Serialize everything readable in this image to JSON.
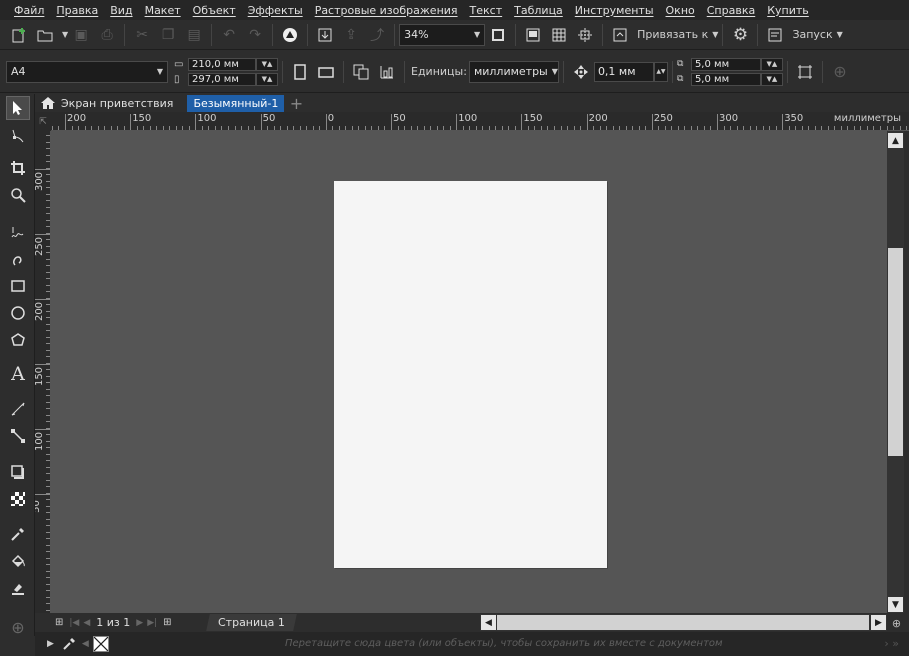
{
  "menu": [
    "Файл",
    "Правка",
    "Вид",
    "Макет",
    "Объект",
    "Эффекты",
    "Растровые изображения",
    "Текст",
    "Таблица",
    "Инструменты",
    "Окно",
    "Справка",
    "Купить"
  ],
  "toolbar1": {
    "zoom": "34%",
    "snap_label": "Привязать к",
    "launch_label": "Запуск"
  },
  "toolbar2": {
    "page_size": "A4",
    "width": "210,0 мм",
    "height": "297,0 мм",
    "units_label": "Единицы:",
    "units_value": "миллиметры",
    "nudge": "0,1 мм",
    "dup_x": "5,0 мм",
    "dup_y": "5,0 мм"
  },
  "tabs": {
    "welcome": "Экран приветствия",
    "document": "Безымянный-1"
  },
  "ruler": {
    "h_labels": [
      "200",
      "150",
      "100",
      "50",
      "0",
      "50",
      "100",
      "150",
      "200",
      "250",
      "300",
      "350"
    ],
    "h_unit": "миллиметры",
    "v_labels": [
      "300",
      "250",
      "200",
      "150",
      "100",
      "50"
    ]
  },
  "pager": {
    "counter": "1 из 1",
    "page_tab": "Страница 1"
  },
  "status": {
    "hint": "Перетащите сюда цвета (или объекты), чтобы сохранить их вместе с документом"
  }
}
